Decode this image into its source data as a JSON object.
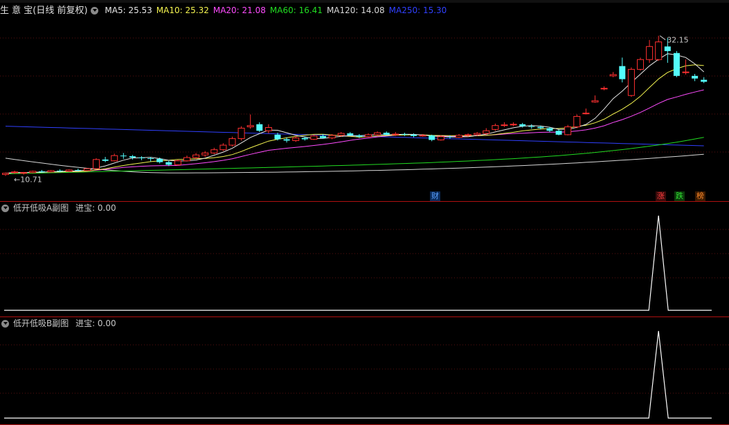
{
  "header": {
    "title": "生 意 宝(日线 前复权)",
    "ma": [
      {
        "label": "MA5: 25.53",
        "color": "#e8e8e8"
      },
      {
        "label": "MA10: 25.32",
        "color": "#f5f550"
      },
      {
        "label": "MA20: 21.08",
        "color": "#ff4cff"
      },
      {
        "label": "MA60: 16.41",
        "color": "#22dd22"
      },
      {
        "label": "MA120: 14.08",
        "color": "#d8d8d8"
      },
      {
        "label": "MA250: 15.30",
        "color": "#3040ff"
      }
    ]
  },
  "price_panel": {
    "high_label": "32.15",
    "low_label": "10.71",
    "y_range": [
      8.0,
      35.5
    ],
    "badges": [
      {
        "text": "财",
        "color": "#5aa0ff",
        "bg": "#0a2a5a"
      },
      {
        "text": "涨",
        "color": "#ff4040",
        "bg": "#3a0a0a"
      },
      {
        "text": "跌",
        "color": "#33dd33",
        "bg": "#0a3a0a"
      },
      {
        "text": "榜",
        "color": "#ff8a2a",
        "bg": "#3a1a00"
      }
    ],
    "candles": [
      [
        10.9,
        11.1,
        10.7,
        11.2
      ],
      [
        11.2,
        11.3,
        11.0,
        11.5
      ],
      [
        11.1,
        11.2,
        10.9,
        11.3
      ],
      [
        11.2,
        11.4,
        11.1,
        11.5
      ],
      [
        11.4,
        11.3,
        11.2,
        11.6
      ],
      [
        11.3,
        11.5,
        11.2,
        11.6
      ],
      [
        11.5,
        11.4,
        11.3,
        11.7
      ],
      [
        11.4,
        11.6,
        11.3,
        11.7
      ],
      [
        11.6,
        11.5,
        11.4,
        11.8
      ],
      [
        11.5,
        11.8,
        11.4,
        11.9
      ],
      [
        11.8,
        13.2,
        11.7,
        13.4
      ],
      [
        13.2,
        13.0,
        12.8,
        13.6
      ],
      [
        13.0,
        13.8,
        12.9,
        14.1
      ],
      [
        13.8,
        13.7,
        13.3,
        14.2
      ],
      [
        13.7,
        13.5,
        13.2,
        13.9
      ],
      [
        13.5,
        13.4,
        13.1,
        13.7
      ],
      [
        13.4,
        13.3,
        12.9,
        13.6
      ],
      [
        13.3,
        12.8,
        12.6,
        13.5
      ],
      [
        12.8,
        12.4,
        12.2,
        13.0
      ],
      [
        12.4,
        13.0,
        12.3,
        13.2
      ],
      [
        13.0,
        13.5,
        12.9,
        13.8
      ],
      [
        13.5,
        13.9,
        13.3,
        14.2
      ],
      [
        13.9,
        14.2,
        13.6,
        14.5
      ],
      [
        14.2,
        14.7,
        14.0,
        15.0
      ],
      [
        14.7,
        15.4,
        14.5,
        15.7
      ],
      [
        15.4,
        16.4,
        15.2,
        16.7
      ],
      [
        16.4,
        18.0,
        16.1,
        18.3
      ],
      [
        18.2,
        18.4,
        17.9,
        20.1
      ],
      [
        18.6,
        17.6,
        17.4,
        18.9
      ],
      [
        17.6,
        18.1,
        17.2,
        18.6
      ],
      [
        17.0,
        16.3,
        16.1,
        17.3
      ],
      [
        16.3,
        16.1,
        15.8,
        16.6
      ],
      [
        16.1,
        16.5,
        15.9,
        16.8
      ],
      [
        16.5,
        16.3,
        16.1,
        16.7
      ],
      [
        16.3,
        16.8,
        16.2,
        17.0
      ],
      [
        16.8,
        16.5,
        16.4,
        17.1
      ],
      [
        16.5,
        16.9,
        16.3,
        17.1
      ],
      [
        16.9,
        17.2,
        16.7,
        17.4
      ],
      [
        17.2,
        16.9,
        16.8,
        17.4
      ],
      [
        16.9,
        16.7,
        16.5,
        17.1
      ],
      [
        16.7,
        17.0,
        16.6,
        17.2
      ],
      [
        17.0,
        17.3,
        16.8,
        17.5
      ],
      [
        17.3,
        17.0,
        16.9,
        17.5
      ],
      [
        17.0,
        17.1,
        16.8,
        17.4
      ],
      [
        17.1,
        17.0,
        16.8,
        17.3
      ],
      [
        17.0,
        16.8,
        16.6,
        17.2
      ],
      [
        16.8,
        16.9,
        16.7,
        17.1
      ],
      [
        16.9,
        16.2,
        16.0,
        17.0
      ],
      [
        16.2,
        16.7,
        16.1,
        16.9
      ],
      [
        16.7,
        16.6,
        16.4,
        16.9
      ],
      [
        16.6,
        16.9,
        16.5,
        17.1
      ],
      [
        16.9,
        17.0,
        16.7,
        17.2
      ],
      [
        17.0,
        17.2,
        16.8,
        17.4
      ],
      [
        17.2,
        17.6,
        17.0,
        18.0
      ],
      [
        17.8,
        18.4,
        17.6,
        18.7
      ],
      [
        18.5,
        18.5,
        18.2,
        18.9
      ],
      [
        18.5,
        18.6,
        18.3,
        18.9
      ],
      [
        18.6,
        18.3,
        18.1,
        18.8
      ],
      [
        18.3,
        18.2,
        17.9,
        18.6
      ],
      [
        18.2,
        18.0,
        17.8,
        18.4
      ],
      [
        18.0,
        17.6,
        17.4,
        18.2
      ],
      [
        17.6,
        17.0,
        16.9,
        17.8
      ],
      [
        17.0,
        18.2,
        16.9,
        18.5
      ],
      [
        18.2,
        19.8,
        18.0,
        20.1
      ],
      [
        20.2,
        20.3,
        20.1,
        21.0
      ],
      [
        22.0,
        22.2,
        21.9,
        23.0
      ],
      [
        24.0,
        24.1,
        23.8,
        24.4
      ],
      [
        26.0,
        26.2,
        25.8,
        26.6
      ],
      [
        27.5,
        25.5,
        25.0,
        28.8
      ],
      [
        23.0,
        27.0,
        22.8,
        27.3
      ],
      [
        27.0,
        28.5,
        26.8,
        28.8
      ],
      [
        28.5,
        30.5,
        28.0,
        31.5
      ],
      [
        28.5,
        31.2,
        28.3,
        32.15
      ],
      [
        30.5,
        29.8,
        28.0,
        31.8
      ],
      [
        29.5,
        26.0,
        25.8,
        29.8
      ],
      [
        26.5,
        26.6,
        26.2,
        28.5
      ],
      [
        26.0,
        25.6,
        25.2,
        26.3
      ],
      [
        25.4,
        25.1,
        24.9,
        25.8
      ]
    ]
  },
  "sub_panel_a": {
    "title": "低开低吸A副图",
    "value_label": "进宝: 0.00",
    "signal_index": 72
  },
  "sub_panel_b": {
    "title": "低开低吸B副图",
    "value_label": "进宝: 0.00",
    "signal_index": 72
  }
}
